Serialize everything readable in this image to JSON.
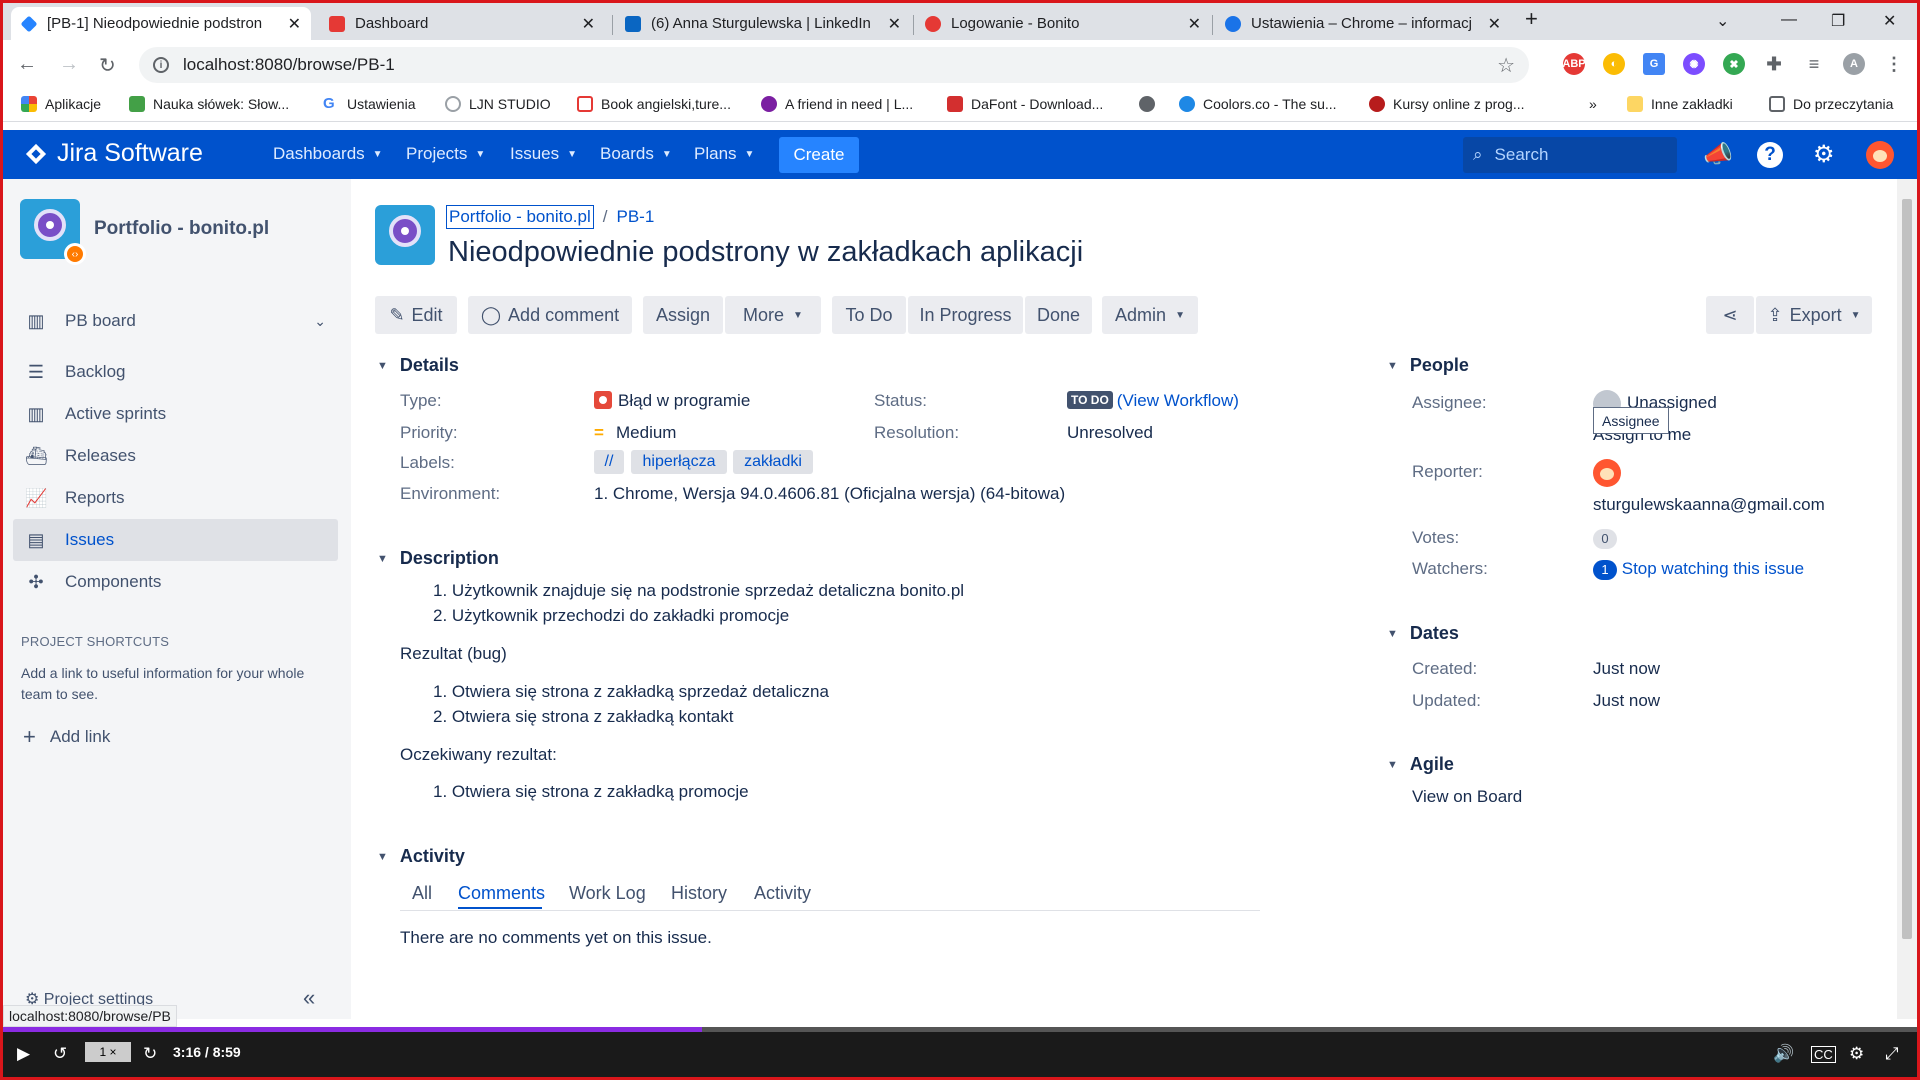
{
  "browser": {
    "tabs": [
      {
        "title": "[PB-1] Nieodpowiednie podstron",
        "color": "#2684ff"
      },
      {
        "title": "Dashboard",
        "color": "#e53935"
      },
      {
        "title": "(6) Anna Sturgulewska | LinkedIn",
        "color": "#0a66c2"
      },
      {
        "title": "Logowanie - Bonito",
        "color": "#e53935"
      },
      {
        "title": "Ustawienia – Chrome – informacj",
        "color": "#1a73e8"
      }
    ],
    "url": "localhost:8080/browse/PB-1",
    "bookmarks": [
      "Aplikacje",
      "Nauka słówek: Słow...",
      "Ustawienia",
      "LJN STUDIO",
      "Book angielski,ture...",
      "A friend in need | L...",
      "DaFont - Download...",
      "Coolors.co - The su...",
      "Kursy online z prog...",
      "Inne zakładki",
      "Do przeczytania"
    ],
    "more_bookmarks": "»",
    "profile_initial": "A"
  },
  "jira": {
    "logo": "Jira Software",
    "nav": [
      "Dashboards",
      "Projects",
      "Issues",
      "Boards",
      "Plans"
    ],
    "create": "Create",
    "search_placeholder": "Search",
    "accent": "#0052cc"
  },
  "sidebar": {
    "project": "Portfolio - bonito.pl",
    "board": "PB board",
    "items": [
      "Backlog",
      "Active sprints",
      "Releases",
      "Reports",
      "Issues",
      "Components"
    ],
    "selected": "Issues",
    "shortcuts_title": "PROJECT SHORTCUTS",
    "shortcuts_desc": "Add a link to useful information for your whole team to see.",
    "add_link": "Add link",
    "project_settings": "Project settings"
  },
  "issue": {
    "breadcrumb_project": "Portfolio - bonito.pl",
    "breadcrumb_sep": "/",
    "key": "PB-1",
    "title": "Nieodpowiednie podstrony w zakładkach aplikacji",
    "actions": [
      "Edit",
      "Add comment",
      "Assign",
      "More",
      "To Do",
      "In Progress",
      "Done",
      "Admin"
    ],
    "export": "Export",
    "details": {
      "heading": "Details",
      "type_label": "Type:",
      "type": "Błąd w programie",
      "priority_label": "Priority:",
      "priority": "Medium",
      "labels_label": "Labels:",
      "labels": [
        "//",
        "hiperłącza",
        "zakładki"
      ],
      "environment_label": "Environment:",
      "environment": "1. Chrome, Wersja 94.0.4606.81 (Oficjalna wersja) (64-bitowa)",
      "status_label": "Status:",
      "status": "TO DO",
      "view_workflow": "(View Workflow)",
      "resolution_label": "Resolution:",
      "resolution": "Unresolved"
    },
    "description": {
      "heading": "Description",
      "steps": [
        "1. Użytkownik znajduje się na podstronie sprzedaż detaliczna bonito.pl",
        "2. Użytkownik przechodzi do zakładki promocje"
      ],
      "result_label": "Rezultat (bug)",
      "results": [
        "1. Otwiera się strona z zakładką sprzedaż detaliczna",
        "2. Otwiera się strona z zakładką kontakt"
      ],
      "expected_label": "Oczekiwany rezultat:",
      "expected": [
        "1. Otwiera się strona z zakładką promocje"
      ]
    },
    "activity": {
      "heading": "Activity",
      "tabs": [
        "All",
        "Comments",
        "Work Log",
        "History",
        "Activity"
      ],
      "selected": "Comments",
      "empty": "There are no comments yet on this issue."
    },
    "people": {
      "heading": "People",
      "assignee_label": "Assignee:",
      "assignee": "Unassigned",
      "assign_to_me": "Assign to me",
      "tooltip": "Assignee",
      "reporter_label": "Reporter:",
      "reporter": "sturgulewskaanna@gmail.com",
      "votes_label": "Votes:",
      "votes": "0",
      "watchers_label": "Watchers:",
      "watchers": "1",
      "stop_watching": "Stop watching this issue"
    },
    "dates": {
      "heading": "Dates",
      "created_label": "Created:",
      "created": "Just now",
      "updated_label": "Updated:",
      "updated": "Just now"
    },
    "agile": {
      "heading": "Agile",
      "view_on_board": "View on Board"
    }
  },
  "status_url": "localhost:8080/browse/PB",
  "player": {
    "speed": "1 ×",
    "time": "3:16 / 8:59",
    "progress": 0.365
  }
}
